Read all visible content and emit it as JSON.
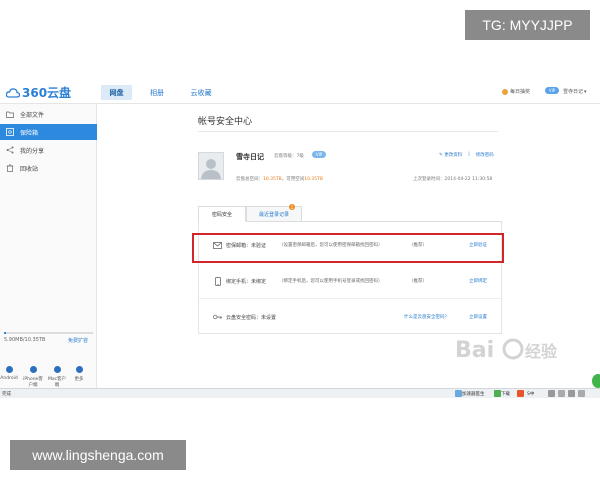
{
  "watermarks": {
    "top": "TG: MYYJJPP",
    "bottom": "www.lingshenga.com"
  },
  "header": {
    "logo_text": "360云盘",
    "tabs": [
      {
        "label": "网盘",
        "active": true
      },
      {
        "label": "相册",
        "active": false
      },
      {
        "label": "云收藏",
        "active": false
      }
    ],
    "daily_signin": "每日抽奖",
    "vip_badge": "VIP",
    "user_menu": "雪寺日记"
  },
  "sidebar": {
    "items": [
      {
        "label": "全部文件",
        "icon": "folder-icon",
        "active": false
      },
      {
        "label": "保险箱",
        "icon": "safe-icon",
        "active": true
      },
      {
        "label": "我的分享",
        "icon": "share-icon",
        "active": false
      },
      {
        "label": "回收站",
        "icon": "trash-icon",
        "active": false
      }
    ],
    "quota_text": "5.90MB/10.35TB",
    "quota_fraction": 0.02,
    "quota_link": "免费扩容",
    "clients": [
      "Android",
      "iPhone客户端",
      "Mac客户端",
      "更多"
    ]
  },
  "main": {
    "page_title": "帐号安全中心",
    "user": {
      "name": "雪寺日记",
      "level": "云盘等级：7级",
      "badge": "VIP",
      "edit_profile": "更改资料",
      "change_password": "修改密码",
      "space_label": "云盘总空间：",
      "space_total": "10.35TB",
      "space_used_label": "，可用空间",
      "space_free": "10.35TB",
      "last_login": "上次登录时间：2014-04-22 11:30:58"
    },
    "tabs": [
      {
        "label": "密码安全",
        "active": true
      },
      {
        "label": "最近登录记录",
        "active": false,
        "badge": "1"
      }
    ],
    "rows": [
      {
        "label": "密保邮箱：未验证",
        "desc": "（设置密保邮箱后，您可以使用密保邮箱找回密码）",
        "recommend": "（推荐）",
        "link": "立即验证",
        "icon": "mail-icon"
      },
      {
        "label": "绑定手机：未绑定",
        "desc": "（绑定手机后，您可以使用手机号登录或找回密码）",
        "recommend": "（推荐）",
        "link": "立即绑定",
        "icon": "phone-icon"
      },
      {
        "label": "云盘安全密码：未设置",
        "mid": "什么是云盘安全密码？",
        "link": "立即设置",
        "icon": "key-icon"
      }
    ]
  },
  "statusbar": {
    "left": "完成",
    "speed_label": "加速器医生",
    "download_label": "下载",
    "ime": "S中"
  },
  "colors": {
    "accent": "#2d89de",
    "highlight": "#d0262c",
    "link": "#2a7bcc",
    "orange": "#e87b1e"
  }
}
